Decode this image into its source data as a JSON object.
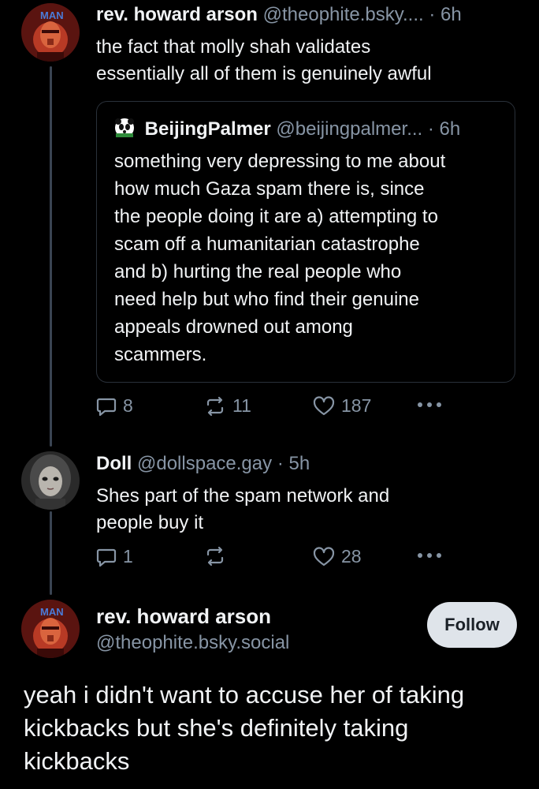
{
  "post1": {
    "author": "rev. howard arson",
    "handle": "@theophite.bsky....",
    "time": "· 6h",
    "avatar_label": "MAN",
    "text_lines": [
      "the fact that molly shah validates",
      "essentially all of them is genuinely awful"
    ],
    "quote": {
      "author": "BeijingPalmer",
      "handle": "@beijingpalmer...",
      "time": "· 6h",
      "text_lines": [
        "something very depressing to me about",
        "how much Gaza spam there is, since",
        "the people doing it are a) attempting to",
        "scam off a humanitarian catastrophe",
        "and b) hurting the real people who",
        "need help but who find their genuine",
        "appeals drowned out among",
        "scammers."
      ]
    },
    "actions": {
      "replies": "8",
      "reposts": "11",
      "likes": "187"
    }
  },
  "post2": {
    "author": "Doll",
    "handle": "@dollspace.gay",
    "time": "· 5h",
    "text_lines": [
      "Shes part of the spam network and",
      "people buy it"
    ],
    "actions": {
      "replies": "1",
      "reposts": "",
      "likes": "28"
    }
  },
  "post3": {
    "author": "rev. howard arson",
    "handle": "@theophite.bsky.social",
    "avatar_label": "MAN",
    "follow_label": "Follow",
    "text_lines": [
      "yeah i didn't want to accuse her of taking",
      "kickbacks but she's definitely taking",
      "kickbacks"
    ]
  },
  "icons": {
    "reply": "reply-bubble-icon",
    "repost": "repost-arrows-icon",
    "like": "heart-icon",
    "more": "more-dots-icon"
  },
  "colors": {
    "background": "#000000",
    "text": "#f1f3f5",
    "muted": "#8795a5",
    "thread_line": "#3a4452",
    "follow_button": "#dfe4ea"
  }
}
